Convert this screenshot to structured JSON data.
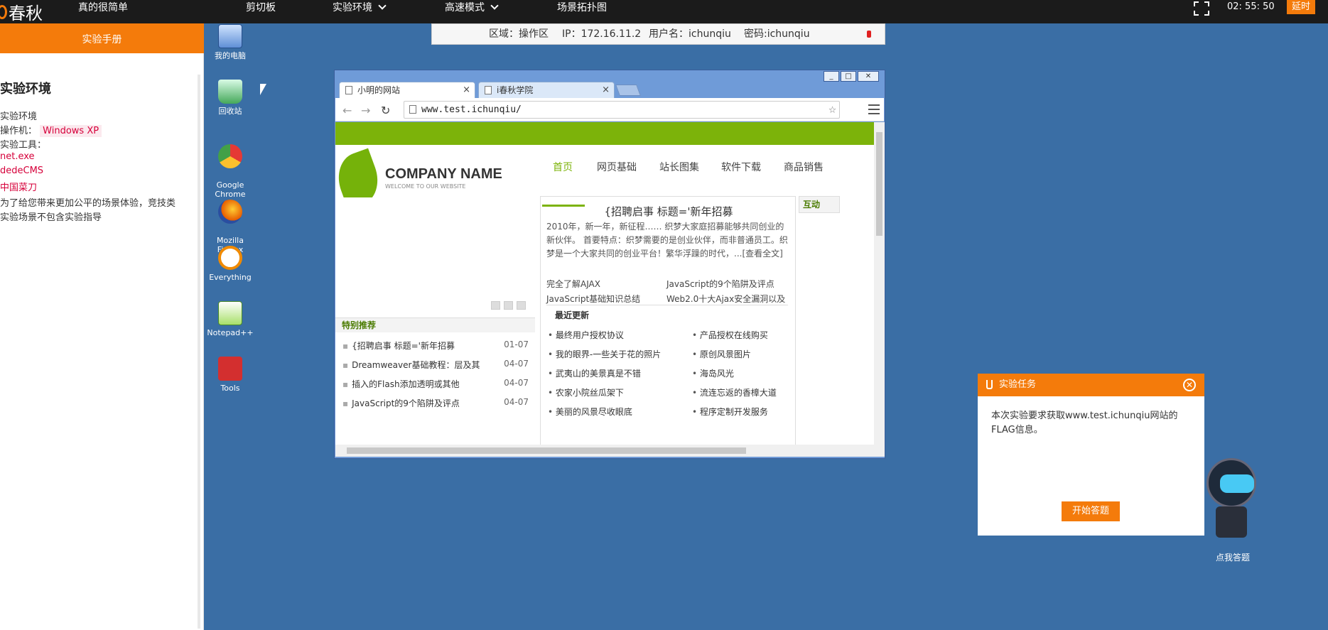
{
  "topbar": {
    "logo_text": "春秋",
    "title": "真的很简单",
    "menu": [
      "剪切板",
      "实验环境",
      "高速模式",
      "场景拓扑图"
    ],
    "timer": "02: 55: 50",
    "extend_label": "延时"
  },
  "sidebar": {
    "header": "实验手册",
    "heading": "实验环境",
    "lines": {
      "env": "实验环境",
      "os_label": "操作机：",
      "os_value": "Windows XP",
      "tools_label": "实验工具：",
      "tool1": "net.exe",
      "tool2": "dedeCMS",
      "tool3": "中国菜刀",
      "note1": "为了给您带来更加公平的场景体验，竞技类",
      "note2": "实验场景不包含实验指导"
    }
  },
  "desktop_icons": [
    {
      "label": "我的电脑",
      "icon": "computer-icon"
    },
    {
      "label": "回收站",
      "icon": "recycle-bin-icon"
    },
    {
      "label": "Google\nChrome",
      "icon": "chrome-icon"
    },
    {
      "label": "Mozilla\nFirefox",
      "icon": "firefox-icon"
    },
    {
      "label": "Everything",
      "icon": "everything-icon"
    },
    {
      "label": "Notepad++",
      "icon": "notepad-icon"
    },
    {
      "label": "Tools",
      "icon": "tools-icon"
    }
  ],
  "infobar": {
    "region": "区域：操作区",
    "ip": "IP：172.16.11.2",
    "user": "用户名：ichunqiu",
    "pass": "密码:ichunqiu"
  },
  "browser": {
    "tabs": [
      {
        "title": "小明的网站",
        "active": true
      },
      {
        "title": "i春秋学院",
        "active": false
      }
    ],
    "url": "www.test.ichunqiu/"
  },
  "website": {
    "brand_name": "COMPANY NAME",
    "brand_sub": "WELCOME TO OUR WEBSITE",
    "nav": [
      "首页",
      "网页基础",
      "站长图集",
      "软件下载",
      "商品销售"
    ],
    "special_title": "特别推荐",
    "special": [
      {
        "title": "{招聘启事 标题='新年招募",
        "date": "01-07"
      },
      {
        "title": "Dreamweaver基础教程：层及其",
        "date": "04-07"
      },
      {
        "title": "插入的Flash添加透明或其他",
        "date": "04-07"
      },
      {
        "title": "JavaScript的9个陷阱及评点",
        "date": "04-07"
      }
    ],
    "main_title": "{招聘启事 标题='新年招募",
    "main_text": "2010年，新一年，新征程…… 织梦大家庭招募能够共同创业的新伙伴。 首要特点：织梦需要的是创业伙伴，而非普通员工。织梦是一个大家共同的创业平台！繁华浮躁的时代，...[查看全文]",
    "links": [
      "完全了解AJAX",
      "JavaScript的9个陷阱及评点",
      "JavaScript基础知识总结",
      "Web2.0十大Ajax安全漏洞以及"
    ],
    "recent_title": "最近更新",
    "recent": [
      "最终用户授权协议",
      "产品授权在线购买",
      "我的眼界-一些关于花的照片",
      "原创风景图片",
      "武夷山的美景真是不错",
      "海岛风光",
      "农家小院丝瓜架下",
      "流连忘返的香樟大道",
      "美丽的风景尽收眼底",
      "程序定制开发服务"
    ],
    "side_title": "互动"
  },
  "task": {
    "title": "实验任务",
    "body": "本次实验要求获取www.test.ichunqiu网站的FLAG信息。",
    "start_button": "开始答题",
    "robot_label": "点我答题"
  },
  "colors": {
    "accent": "#f47b0b",
    "desktop": "#3a6ea5",
    "site_green": "#7cb30a"
  }
}
